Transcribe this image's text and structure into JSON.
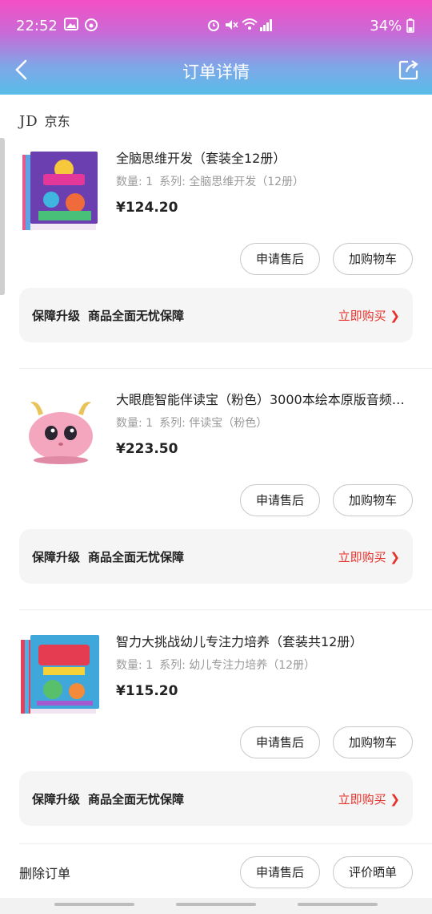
{
  "status_bar": {
    "time": "22:52",
    "battery": "34%"
  },
  "header": {
    "title": "订单详情"
  },
  "shop": {
    "logo": "JD",
    "name": "京东"
  },
  "items": [
    {
      "name": "全脑思维开发（套装全12册）",
      "qty_label": "数量: 1",
      "series_label": "系列: 全脑思维开发（12册）",
      "price": "¥124.20",
      "btn1": "申请售后",
      "btn2": "加购物车",
      "guard_title": "保障升级",
      "guard_desc": "商品全面无忧保障",
      "guard_action": "立即购买 ❯"
    },
    {
      "name": "大眼鹿智能伴读宝（粉色）3000本绘本原版音频…",
      "qty_label": "数量: 1",
      "series_label": "系列: 伴读宝（粉色）",
      "price": "¥223.50",
      "btn1": "申请售后",
      "btn2": "加购物车",
      "guard_title": "保障升级",
      "guard_desc": "商品全面无忧保障",
      "guard_action": "立即购买 ❯"
    },
    {
      "name": "智力大挑战幼儿专注力培养（套装共12册）",
      "qty_label": "数量: 1",
      "series_label": "系列: 幼儿专注力培养（12册）",
      "price": "¥115.20",
      "btn1": "申请售后",
      "btn2": "加购物车",
      "guard_title": "保障升级",
      "guard_desc": "商品全面无忧保障",
      "guard_action": "立即购买 ❯"
    }
  ],
  "bottom": {
    "delete_label": "删除订单",
    "after_sale": "申请售后",
    "review": "评价晒单"
  },
  "colors": {
    "accent_red": "#e6312a",
    "header_top": "#f54fc4",
    "header_bottom": "#58bde9"
  }
}
